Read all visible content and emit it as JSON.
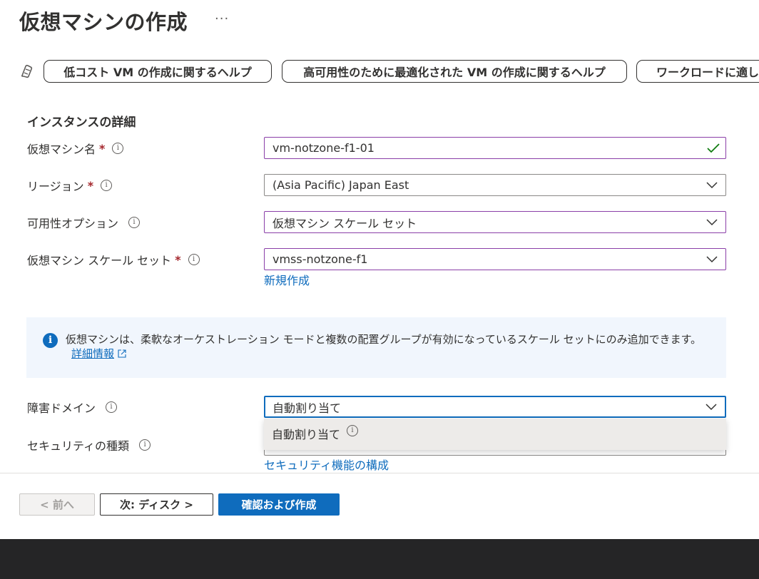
{
  "header": {
    "title": "仮想マシンの作成",
    "more_label": "···"
  },
  "help_pills": [
    {
      "label": "低コスト VM の作成に関するヘルプ"
    },
    {
      "label": "高可用性のために最適化された VM の作成に関するヘルプ"
    },
    {
      "label": "ワークロードに適し"
    }
  ],
  "section": {
    "heading": "インスタンスの詳細"
  },
  "fields": {
    "vm_name": {
      "label": "仮想マシン名",
      "required": "*",
      "value": "vm-notzone-f1-01"
    },
    "region": {
      "label": "リージョン",
      "required": "*",
      "value": "(Asia Pacific) Japan East"
    },
    "availability": {
      "label": "可用性オプション",
      "value": "仮想マシン スケール セット"
    },
    "scale_set": {
      "label": "仮想マシン スケール セット",
      "required": "*",
      "value": "vmss-notzone-f1",
      "create_new_link": "新規作成"
    },
    "fault_domain": {
      "label": "障害ドメイン",
      "value": "自動割り当て",
      "option": "自動割り当て"
    },
    "security_type": {
      "label": "セキュリティの種類",
      "configure_link": "セキュリティ機能の構成"
    }
  },
  "info_banner": {
    "text": "仮想マシンは、柔軟なオーケストレーション モードと複数の配置グループが有効になっているスケール セットにのみ追加できます。",
    "link": "詳細情報"
  },
  "footer": {
    "prev_label": "< 前へ",
    "next_label": "次: ディスク >",
    "review_label": "確認および作成"
  },
  "colors": {
    "accent": "#0f6cbd",
    "required": "#a4262c",
    "valid_border": "#8a3ea8",
    "success": "#107c10"
  }
}
